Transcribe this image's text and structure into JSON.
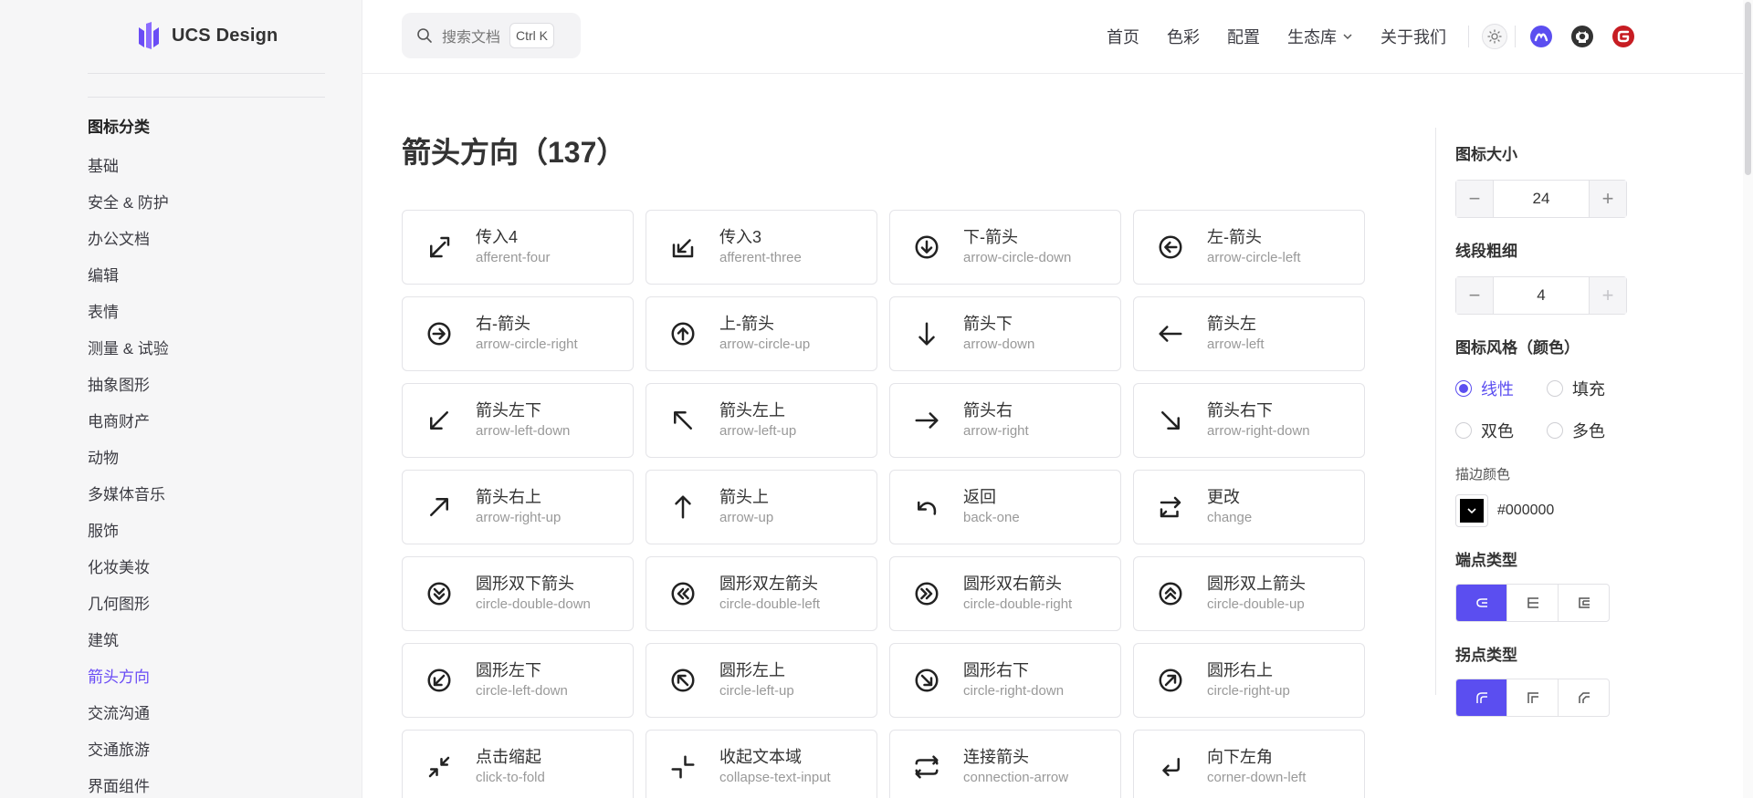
{
  "app": {
    "logo_text": "UCS Design"
  },
  "header": {
    "search_placeholder": "搜索文档",
    "search_shortcut": "Ctrl K",
    "nav": [
      "首页",
      "色彩",
      "配置",
      "生态库",
      "关于我们"
    ]
  },
  "sidebar": {
    "title": "图标分类",
    "items": [
      "基础",
      "安全 & 防护",
      "办公文档",
      "编辑",
      "表情",
      "测量 & 试验",
      "抽象图形",
      "电商财产",
      "动物",
      "多媒体音乐",
      "服饰",
      "化妆美妆",
      "几何图形",
      "建筑",
      "箭头方向",
      "交流沟通",
      "交通旅游",
      "界面组件"
    ],
    "active_index": 14
  },
  "main": {
    "title": "箭头方向（137）",
    "icons": [
      {
        "zh": "传入4",
        "en": "afferent-four",
        "icon": "afferent-four"
      },
      {
        "zh": "传入3",
        "en": "afferent-three",
        "icon": "afferent-three"
      },
      {
        "zh": "下-箭头",
        "en": "arrow-circle-down",
        "icon": "arrow-circle-down"
      },
      {
        "zh": "左-箭头",
        "en": "arrow-circle-left",
        "icon": "arrow-circle-left"
      },
      {
        "zh": "右-箭头",
        "en": "arrow-circle-right",
        "icon": "arrow-circle-right"
      },
      {
        "zh": "上-箭头",
        "en": "arrow-circle-up",
        "icon": "arrow-circle-up"
      },
      {
        "zh": "箭头下",
        "en": "arrow-down",
        "icon": "arrow-down"
      },
      {
        "zh": "箭头左",
        "en": "arrow-left",
        "icon": "arrow-left"
      },
      {
        "zh": "箭头左下",
        "en": "arrow-left-down",
        "icon": "arrow-left-down"
      },
      {
        "zh": "箭头左上",
        "en": "arrow-left-up",
        "icon": "arrow-left-up"
      },
      {
        "zh": "箭头右",
        "en": "arrow-right",
        "icon": "arrow-right"
      },
      {
        "zh": "箭头右下",
        "en": "arrow-right-down",
        "icon": "arrow-right-down"
      },
      {
        "zh": "箭头右上",
        "en": "arrow-right-up",
        "icon": "arrow-right-up"
      },
      {
        "zh": "箭头上",
        "en": "arrow-up",
        "icon": "arrow-up"
      },
      {
        "zh": "返回",
        "en": "back-one",
        "icon": "back-one"
      },
      {
        "zh": "更改",
        "en": "change",
        "icon": "change"
      },
      {
        "zh": "圆形双下箭头",
        "en": "circle-double-down",
        "icon": "circle-double-down"
      },
      {
        "zh": "圆形双左箭头",
        "en": "circle-double-left",
        "icon": "circle-double-left"
      },
      {
        "zh": "圆形双右箭头",
        "en": "circle-double-right",
        "icon": "circle-double-right"
      },
      {
        "zh": "圆形双上箭头",
        "en": "circle-double-up",
        "icon": "circle-double-up"
      },
      {
        "zh": "圆形左下",
        "en": "circle-left-down",
        "icon": "circle-left-down"
      },
      {
        "zh": "圆形左上",
        "en": "circle-left-up",
        "icon": "circle-left-up"
      },
      {
        "zh": "圆形右下",
        "en": "circle-right-down",
        "icon": "circle-right-down"
      },
      {
        "zh": "圆形右上",
        "en": "circle-right-up",
        "icon": "circle-right-up"
      },
      {
        "zh": "点击缩起",
        "en": "click-to-fold",
        "icon": "click-to-fold"
      },
      {
        "zh": "收起文本域",
        "en": "collapse-text-input",
        "icon": "collapse-text-input"
      },
      {
        "zh": "连接箭头",
        "en": "connection-arrow",
        "icon": "connection-arrow"
      },
      {
        "zh": "向下左角",
        "en": "corner-down-left",
        "icon": "corner-down-left"
      }
    ]
  },
  "panel": {
    "size_label": "图标大小",
    "size_value": "24",
    "stroke_label": "线段粗细",
    "stroke_value": "4",
    "style_label": "图标风格（颜色）",
    "styles": [
      "线性",
      "填充",
      "双色",
      "多色"
    ],
    "style_selected": 0,
    "stroke_color_label": "描边颜色",
    "stroke_color": "#000000",
    "linecap_label": "端点类型",
    "linejoin_label": "拐点类型"
  },
  "colors": {
    "accent": "#5b4ef0",
    "active_nav": "#6a4cf5"
  }
}
